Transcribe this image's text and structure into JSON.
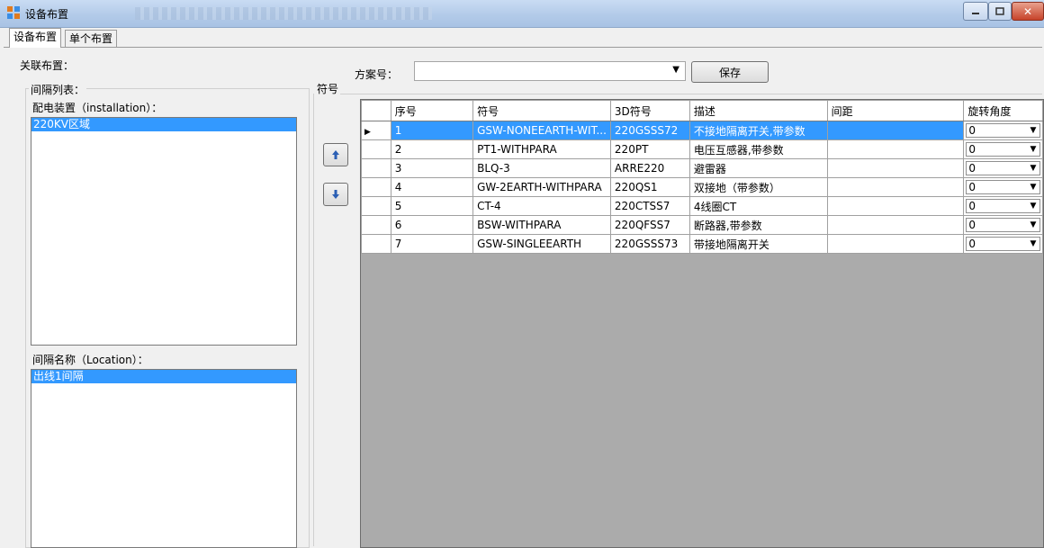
{
  "window": {
    "title": "设备布置"
  },
  "tabs": [
    {
      "label": "设备布置"
    },
    {
      "label": "单个布置"
    }
  ],
  "association": {
    "label": "关联布置："
  },
  "bay_list": {
    "label": "间隔列表：",
    "installation_label": "配电装置（installation）：",
    "installation_items": [
      "220KV区域"
    ],
    "location_label": "间隔名称（Location）：",
    "location_items": [
      "出线1间隔"
    ]
  },
  "scheme": {
    "label": "方案号：",
    "value": "",
    "save_label": "保存"
  },
  "symbol_group": {
    "label": "符号"
  },
  "grid": {
    "columns": [
      "序号",
      "符号",
      "3D符号",
      "描述",
      "间距",
      "旋转角度"
    ],
    "rows": [
      {
        "no": "1",
        "symbol": "GSW-NONEEARTH-WIT...",
        "sym3d": "220GSSS72",
        "desc": "不接地隔离开关,带参数",
        "spacing": "",
        "angle": "0"
      },
      {
        "no": "2",
        "symbol": "PT1-WITHPARA",
        "sym3d": "220PT",
        "desc": "电压互感器,带参数",
        "spacing": "",
        "angle": "0"
      },
      {
        "no": "3",
        "symbol": "BLQ-3",
        "sym3d": "ARRE220",
        "desc": "避雷器",
        "spacing": "",
        "angle": "0"
      },
      {
        "no": "4",
        "symbol": "GW-2EARTH-WITHPARA",
        "sym3d": "220QS1",
        "desc": "双接地（带参数）",
        "spacing": "",
        "angle": "0"
      },
      {
        "no": "5",
        "symbol": "CT-4",
        "sym3d": "220CTSS7",
        "desc": "4线圈CT",
        "spacing": "",
        "angle": "0"
      },
      {
        "no": "6",
        "symbol": "BSW-WITHPARA",
        "sym3d": "220QFSS7",
        "desc": "断路器,带参数",
        "spacing": "",
        "angle": "0"
      },
      {
        "no": "7",
        "symbol": "GSW-SINGLEEARTH",
        "sym3d": "220GSSS73",
        "desc": "带接地隔离开关",
        "spacing": "",
        "angle": "0"
      }
    ]
  },
  "icons": {
    "move_up": "arrow-up-icon",
    "move_down": "arrow-down-icon",
    "row_pointer": "triangle-right-icon"
  },
  "colors": {
    "selection": "#3399ff",
    "grid_background": "#ababab"
  }
}
